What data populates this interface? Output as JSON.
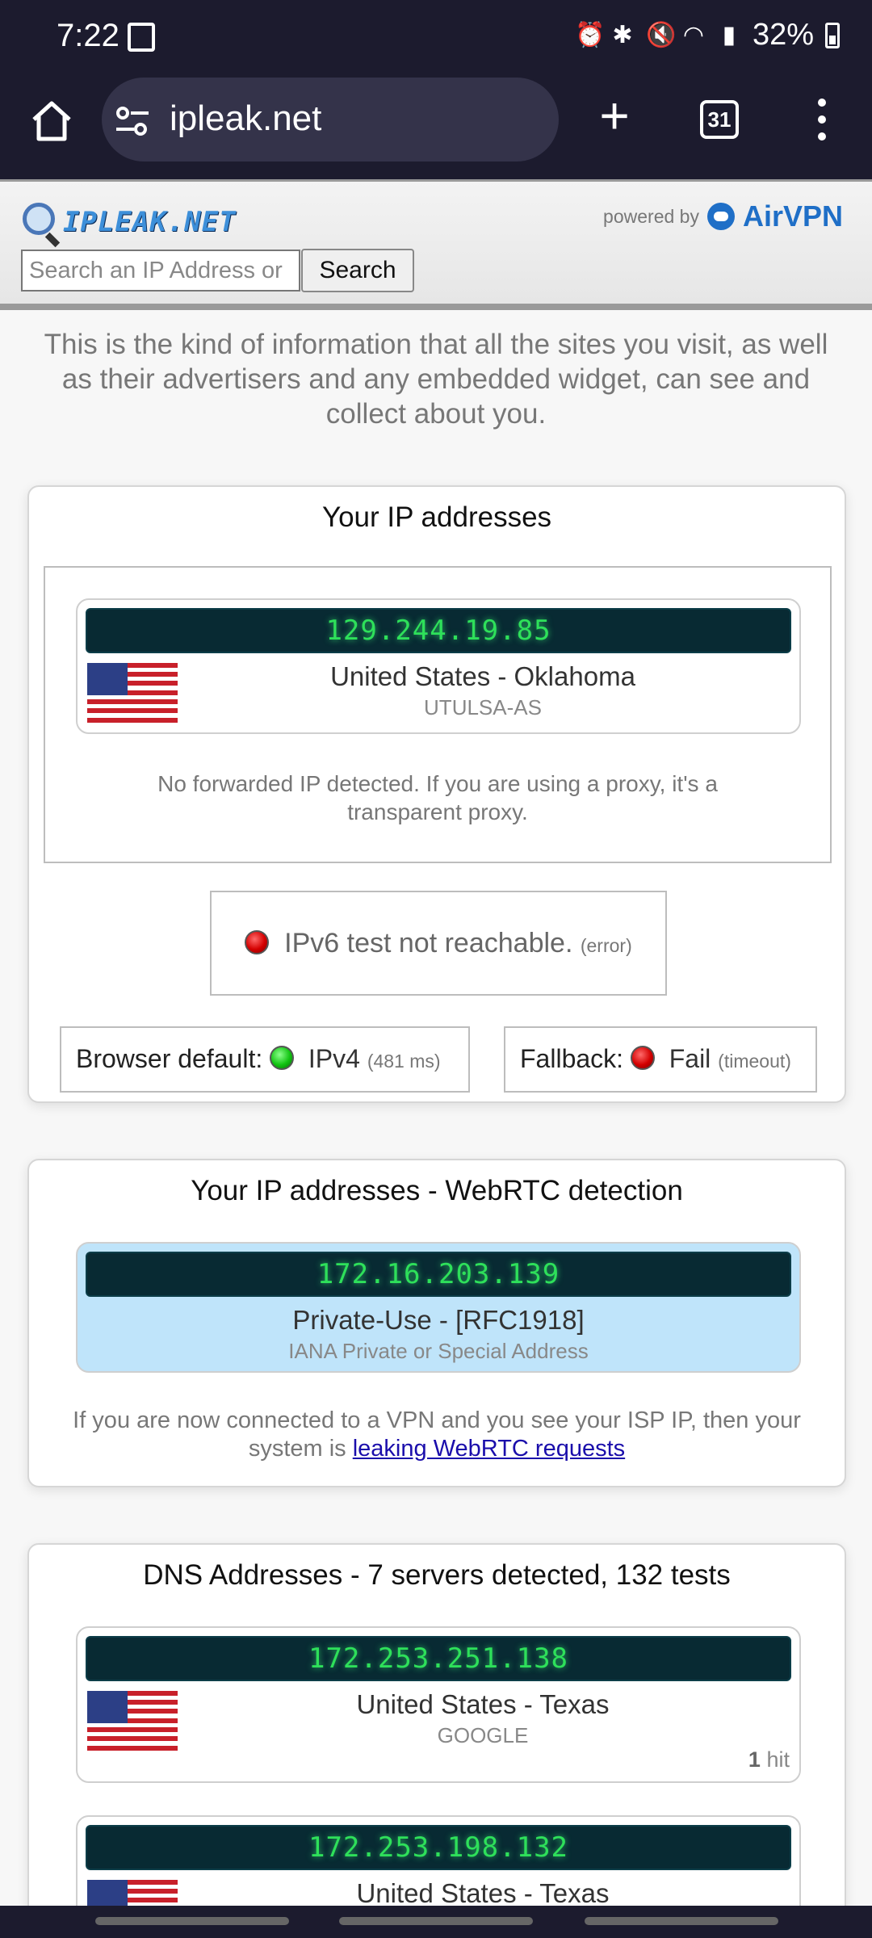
{
  "status": {
    "time": "7:22",
    "battery": "32%",
    "icons": [
      "screenshot-icon",
      "alarm-icon",
      "bluetooth-icon",
      "mute-icon",
      "wifi-icon",
      "signal-icon"
    ]
  },
  "browser": {
    "url": "ipleak.net",
    "tab_count": "31"
  },
  "header": {
    "logo_text": "IPLEAK.NET",
    "powered_by": "powered by",
    "brand": "AirVPN",
    "search_placeholder": "Search an IP Address or",
    "search_button": "Search"
  },
  "intro": "This is the kind of information that all the sites you visit, as well as their advertisers and any embedded widget, can see and collect about you.",
  "ip_section": {
    "title": "Your IP addresses",
    "ip": "129.244.19.85",
    "location": "United States - Oklahoma",
    "isp": "UTULSA-AS",
    "forwarded_note": "No forwarded IP detected. If you are using a proxy, it's a transparent proxy.",
    "ipv6_text": "IPv6 test not reachable.",
    "ipv6_note": "(error)",
    "browser_default_label": "Browser default:",
    "browser_default_value": "IPv4",
    "browser_default_time": "(481 ms)",
    "fallback_label": "Fallback:",
    "fallback_value": "Fail",
    "fallback_note": "(timeout)"
  },
  "webrtc_section": {
    "title": "Your IP addresses - WebRTC detection",
    "ip": "172.16.203.139",
    "location": "Private-Use - [RFC1918]",
    "isp": "IANA Private or Special Address",
    "note_prefix": "If you are now connected to a VPN and you see your ISP IP, then your system is ",
    "note_link": "leaking WebRTC requests"
  },
  "dns_section": {
    "title": "DNS Addresses - 7 servers detected, 132 tests",
    "servers": [
      {
        "ip": "172.253.251.138",
        "location": "United States - Texas",
        "isp": "GOOGLE",
        "hits_count": "1",
        "hits_label": "hit"
      },
      {
        "ip": "172.253.198.132",
        "location": "United States - Texas"
      }
    ]
  }
}
